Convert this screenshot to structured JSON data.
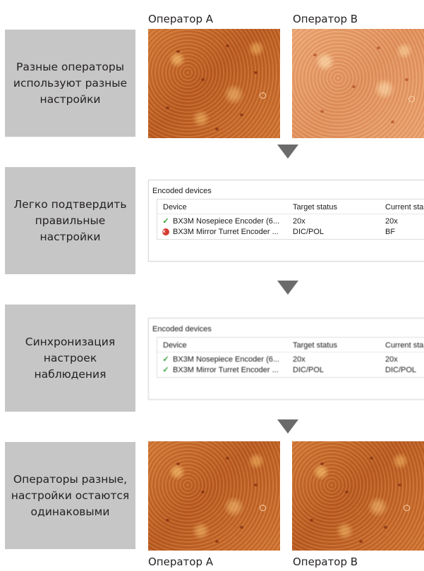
{
  "header": {
    "operator_a": "Оператор A",
    "operator_b": "Оператор B"
  },
  "steps": [
    {
      "text": "Разные операторы\nиспользуют разные\nнастройки"
    },
    {
      "text": "Легко подтвердить\nправильные\nнастройки"
    },
    {
      "text": "Синхронизация\nнастроек\nнаблюдения"
    },
    {
      "text": "Операторы разные,\nнастройки остаются\nодинаковыми"
    }
  ],
  "footer": {
    "operator_a": "Оператор A",
    "operator_b": "Оператор B"
  },
  "panel_mismatch": {
    "title": "Encoded devices",
    "columns": [
      "Device",
      "Target status",
      "Current sta"
    ],
    "rows": [
      {
        "icon": "check-icon",
        "device": "BX3M Nosepiece Encoder (6...",
        "target": "20x",
        "current": "20x"
      },
      {
        "icon": "error-icon",
        "device": "BX3M Mirror Turret Encoder ...",
        "target": "DIC/POL",
        "current": "BF"
      }
    ]
  },
  "panel_synced": {
    "title": "Encoded devices",
    "columns": [
      "Device",
      "Target status",
      "Current sta"
    ],
    "rows": [
      {
        "icon": "check-icon",
        "device": "BX3M Nosepiece Encoder (6...",
        "target": "20x",
        "current": "20x"
      },
      {
        "icon": "check-icon",
        "device": "BX3M Mirror Turret Encoder ...",
        "target": "DIC/POL",
        "current": "DIC/POL"
      }
    ]
  },
  "colors": {
    "step_box": "#c6c6c6",
    "arrow": "#6b6b6b",
    "ok": "#2f9a2f",
    "error": "#d63b2f",
    "sample_dark": "#c9692a",
    "sample_pale": "#e59866"
  }
}
